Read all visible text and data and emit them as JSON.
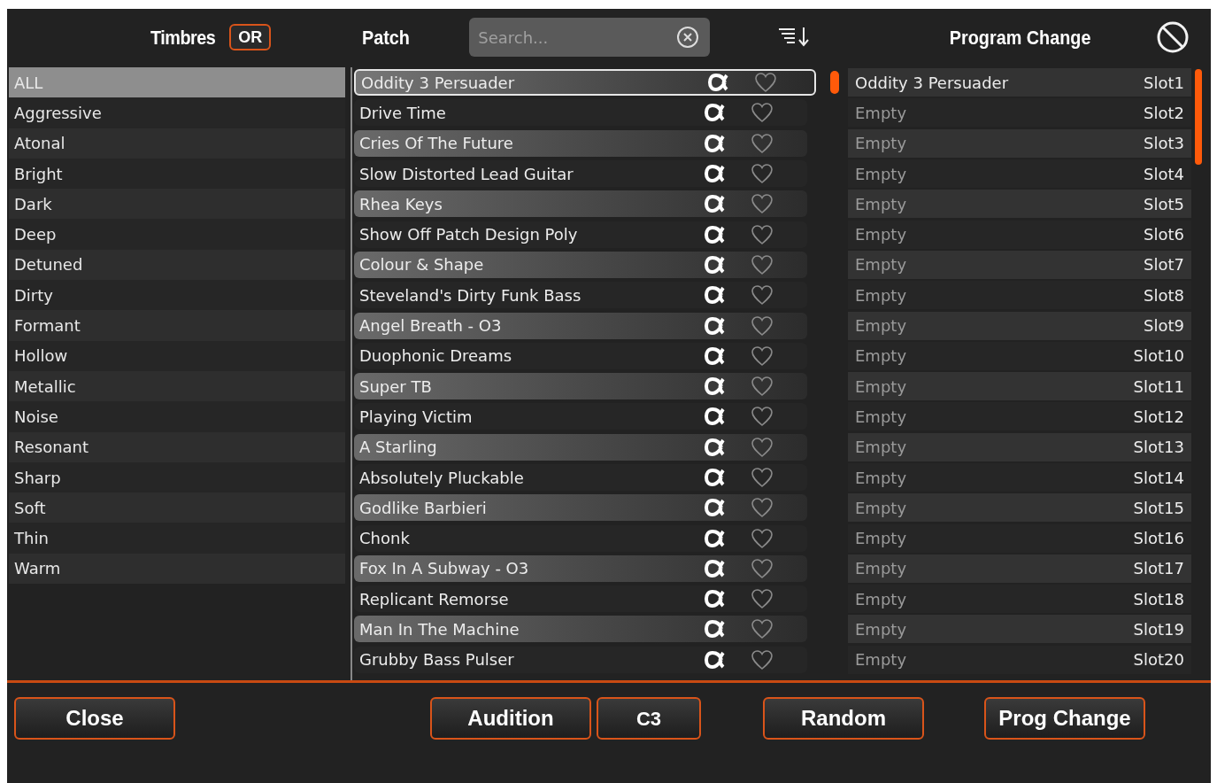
{
  "header": {
    "timbres_label": "Timbres",
    "or_button": "OR",
    "patch_label": "Patch",
    "search": {
      "placeholder": "Search..."
    },
    "program_change_label": "Program Change"
  },
  "timbres": [
    {
      "label": "ALL",
      "selected": true
    },
    {
      "label": "Aggressive",
      "selected": false
    },
    {
      "label": "Atonal",
      "selected": false
    },
    {
      "label": "Bright",
      "selected": false
    },
    {
      "label": "Dark",
      "selected": false
    },
    {
      "label": "Deep",
      "selected": false
    },
    {
      "label": "Detuned",
      "selected": false
    },
    {
      "label": "Dirty",
      "selected": false
    },
    {
      "label": "Formant",
      "selected": false
    },
    {
      "label": "Hollow",
      "selected": false
    },
    {
      "label": "Metallic",
      "selected": false
    },
    {
      "label": "Noise",
      "selected": false
    },
    {
      "label": "Resonant",
      "selected": false
    },
    {
      "label": "Sharp",
      "selected": false
    },
    {
      "label": "Soft",
      "selected": false
    },
    {
      "label": "Thin",
      "selected": false
    },
    {
      "label": "Warm",
      "selected": false
    }
  ],
  "patches": [
    {
      "name": "Oddity 3 Persuader",
      "selected": true,
      "favorite": false
    },
    {
      "name": "Drive Time",
      "selected": false,
      "favorite": false
    },
    {
      "name": "Cries Of The Future",
      "selected": false,
      "favorite": false
    },
    {
      "name": "Slow Distorted Lead Guitar",
      "selected": false,
      "favorite": false
    },
    {
      "name": "Rhea Keys",
      "selected": false,
      "favorite": false
    },
    {
      "name": "Show Off Patch Design Poly",
      "selected": false,
      "favorite": false
    },
    {
      "name": "Colour & Shape",
      "selected": false,
      "favorite": false
    },
    {
      "name": "Steveland's Dirty Funk Bass",
      "selected": false,
      "favorite": false
    },
    {
      "name": "Angel Breath - O3",
      "selected": false,
      "favorite": false
    },
    {
      "name": "Duophonic Dreams",
      "selected": false,
      "favorite": false
    },
    {
      "name": "Super TB",
      "selected": false,
      "favorite": false
    },
    {
      "name": "Playing Victim",
      "selected": false,
      "favorite": false
    },
    {
      "name": "A Starling",
      "selected": false,
      "favorite": false
    },
    {
      "name": "Absolutely Pluckable",
      "selected": false,
      "favorite": false
    },
    {
      "name": "Godlike Barbieri",
      "selected": false,
      "favorite": false
    },
    {
      "name": "Chonk",
      "selected": false,
      "favorite": false
    },
    {
      "name": "Fox In A Subway - O3",
      "selected": false,
      "favorite": false
    },
    {
      "name": "Replicant Remorse",
      "selected": false,
      "favorite": false
    },
    {
      "name": "Man In The Machine",
      "selected": false,
      "favorite": false
    },
    {
      "name": "Grubby Bass Pulser",
      "selected": false,
      "favorite": false
    }
  ],
  "program_slots": [
    {
      "patch": "Oddity 3 Persuader",
      "slot": "Slot1",
      "selected": true
    },
    {
      "patch": "Empty",
      "slot": "Slot2",
      "selected": false
    },
    {
      "patch": "Empty",
      "slot": "Slot3",
      "selected": false
    },
    {
      "patch": "Empty",
      "slot": "Slot4",
      "selected": false
    },
    {
      "patch": "Empty",
      "slot": "Slot5",
      "selected": false
    },
    {
      "patch": "Empty",
      "slot": "Slot6",
      "selected": false
    },
    {
      "patch": "Empty",
      "slot": "Slot7",
      "selected": false
    },
    {
      "patch": "Empty",
      "slot": "Slot8",
      "selected": false
    },
    {
      "patch": "Empty",
      "slot": "Slot9",
      "selected": false
    },
    {
      "patch": "Empty",
      "slot": "Slot10",
      "selected": false
    },
    {
      "patch": "Empty",
      "slot": "Slot11",
      "selected": false
    },
    {
      "patch": "Empty",
      "slot": "Slot12",
      "selected": false
    },
    {
      "patch": "Empty",
      "slot": "Slot13",
      "selected": false
    },
    {
      "patch": "Empty",
      "slot": "Slot14",
      "selected": false
    },
    {
      "patch": "Empty",
      "slot": "Slot15",
      "selected": false
    },
    {
      "patch": "Empty",
      "slot": "Slot16",
      "selected": false
    },
    {
      "patch": "Empty",
      "slot": "Slot17",
      "selected": false
    },
    {
      "patch": "Empty",
      "slot": "Slot18",
      "selected": false
    },
    {
      "patch": "Empty",
      "slot": "Slot19",
      "selected": false
    },
    {
      "patch": "Empty",
      "slot": "Slot20",
      "selected": false
    }
  ],
  "buttons": {
    "close": "Close",
    "audition": "Audition",
    "note": "C3",
    "random": "Random",
    "prog_change": "Prog Change"
  }
}
